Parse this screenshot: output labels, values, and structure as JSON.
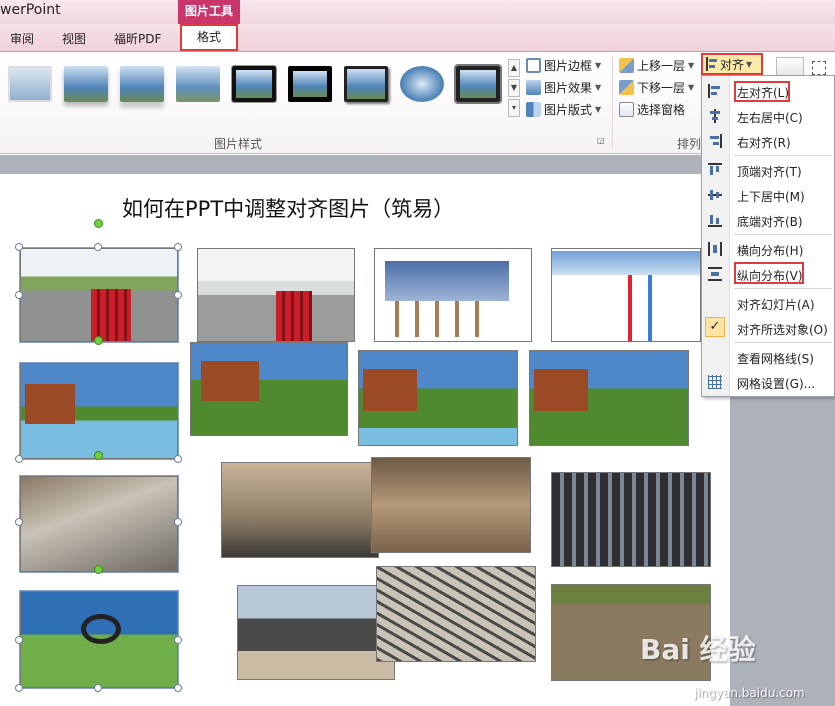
{
  "window": {
    "app_title": "werPoint"
  },
  "context_tab_group": "图片工具",
  "tabs": [
    "审阅",
    "视图",
    "福昕PDF"
  ],
  "active_tab": "格式",
  "ribbon": {
    "picture_styles_label": "图片样式",
    "picture_border": "图片边框",
    "picture_effects": "图片效果",
    "picture_layout": "图片版式",
    "bring_forward": "上移一层",
    "send_backward": "下移一层",
    "selection_pane": "选择窗格",
    "align": "对齐",
    "arrange_label": "排列"
  },
  "slide": {
    "title": "如何在PPT中调整对齐图片（筑易）"
  },
  "align_menu": [
    {
      "label": "左对齐(L)",
      "icon": "align-left-icon",
      "highlighted": true
    },
    {
      "label": "左右居中(C)",
      "icon": "align-center-icon"
    },
    {
      "label": "右对齐(R)",
      "icon": "align-right-icon"
    },
    {
      "label": "顶端对齐(T)",
      "icon": "align-top-icon"
    },
    {
      "label": "上下居中(M)",
      "icon": "align-middle-icon"
    },
    {
      "label": "底端对齐(B)",
      "icon": "align-bottom-icon"
    },
    {
      "label": "横向分布(H)",
      "icon": "distribute-horizontal-icon"
    },
    {
      "label": "纵向分布(V)",
      "icon": "distribute-vertical-icon",
      "highlighted": true
    },
    {
      "label": "对齐幻灯片(A)",
      "icon": ""
    },
    {
      "label": "对齐所选对象(O)",
      "icon": "checkmark-icon",
      "checked": true
    },
    {
      "label": "查看网格线(S)",
      "icon": ""
    },
    {
      "label": "网格设置(G)...",
      "icon": "grid-settings-icon"
    }
  ],
  "watermark": {
    "logo": "Bai 经验",
    "url": "jingyan.baidu.com"
  },
  "colors": {
    "accent_red": "#e23b3b",
    "context_tab": "#c8366a",
    "highlight": "#fde9a8"
  }
}
